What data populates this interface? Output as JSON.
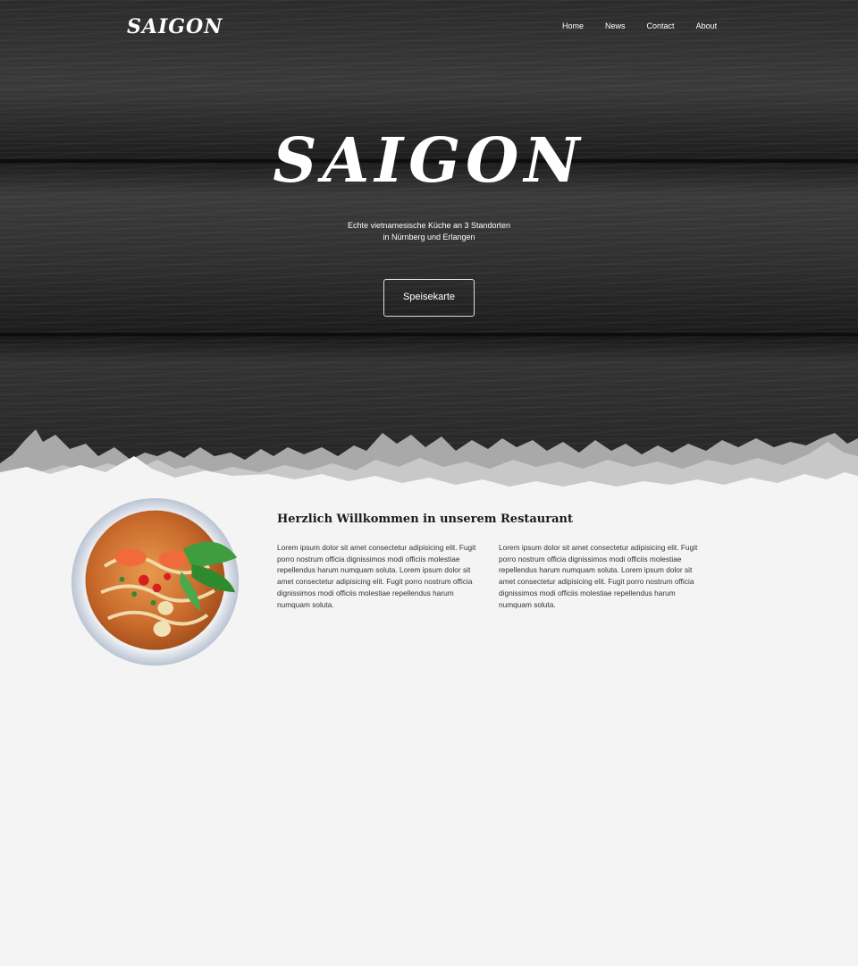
{
  "header": {
    "logo": "SAIGON",
    "nav": [
      "Home",
      "News",
      "Contact",
      "About"
    ]
  },
  "hero": {
    "title": "SAIGON",
    "tagline_line1": "Echte vietnamesische Küche an 3 Standorten",
    "tagline_line2": "in Nürnberg und Erlangen",
    "button_label": "Speisekarte"
  },
  "welcome": {
    "title": "Herzlich Willkommen in unserem Restaurant",
    "column1": "Lorem ipsum dolor sit amet consectetur adipisicing elit. Fugit porro nostrum officia dignissimos modi officiis molestiae repellendus harum numquam soluta. Lorem ipsum dolor sit amet consectetur adipisicing elit. Fugit porro nostrum officia dignissimos modi officiis molestiae repellendus harum numquam soluta.",
    "column2": "Lorem ipsum dolor sit amet consectetur adipisicing elit. Fugit porro nostrum officia dignissimos modi officiis molestiae repellendus harum numquam soluta. Lorem ipsum dolor sit amet consectetur adipisicing elit. Fugit porro nostrum officia dignissimos modi officiis molestiae repellendus harum numquam soluta."
  },
  "colors": {
    "page_background": "#f4f4f4",
    "hero_wood": "#2b2b2b",
    "text_dark": "#1a1a1a",
    "text_light": "#ffffff"
  },
  "icons": {
    "food_image": "noodle-soup-bowl"
  }
}
